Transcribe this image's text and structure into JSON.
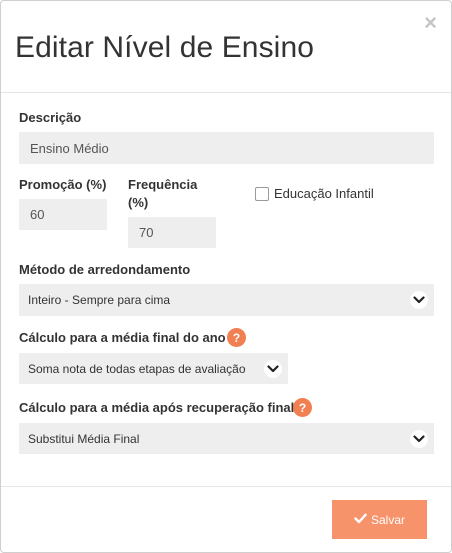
{
  "modal": {
    "title": "Editar Nível de Ensino",
    "close_glyph": "×"
  },
  "fields": {
    "descricao": {
      "label": "Descrição",
      "value": "Ensino Médio"
    },
    "promocao": {
      "label": "Promoção (%)",
      "value": "60"
    },
    "frequencia": {
      "label": "Frequência (%)",
      "value": "70"
    },
    "educacao_infantil": {
      "label": "Educação Infantil",
      "checked": false
    },
    "metodo": {
      "label": "Método de arredondamento",
      "value": "Inteiro - Sempre para cima",
      "icon": "chevron-down-icon"
    },
    "calculo_final": {
      "label": "Cálculo para a média final do ano",
      "value": "Soma nota de todas etapas de avaliação",
      "help": "?",
      "icon": "chevron-down-icon"
    },
    "calculo_recuperacao": {
      "label": "Cálculo para a média após recuperação final",
      "value": "Substitui Média Final",
      "help": "?",
      "icon": "chevron-down-icon"
    }
  },
  "footer": {
    "save_label": "Salvar",
    "save_icon": "check-icon"
  },
  "colors": {
    "accent": "#f6936b",
    "help_badge": "#f07f52",
    "field_bg": "#eeeeee"
  }
}
